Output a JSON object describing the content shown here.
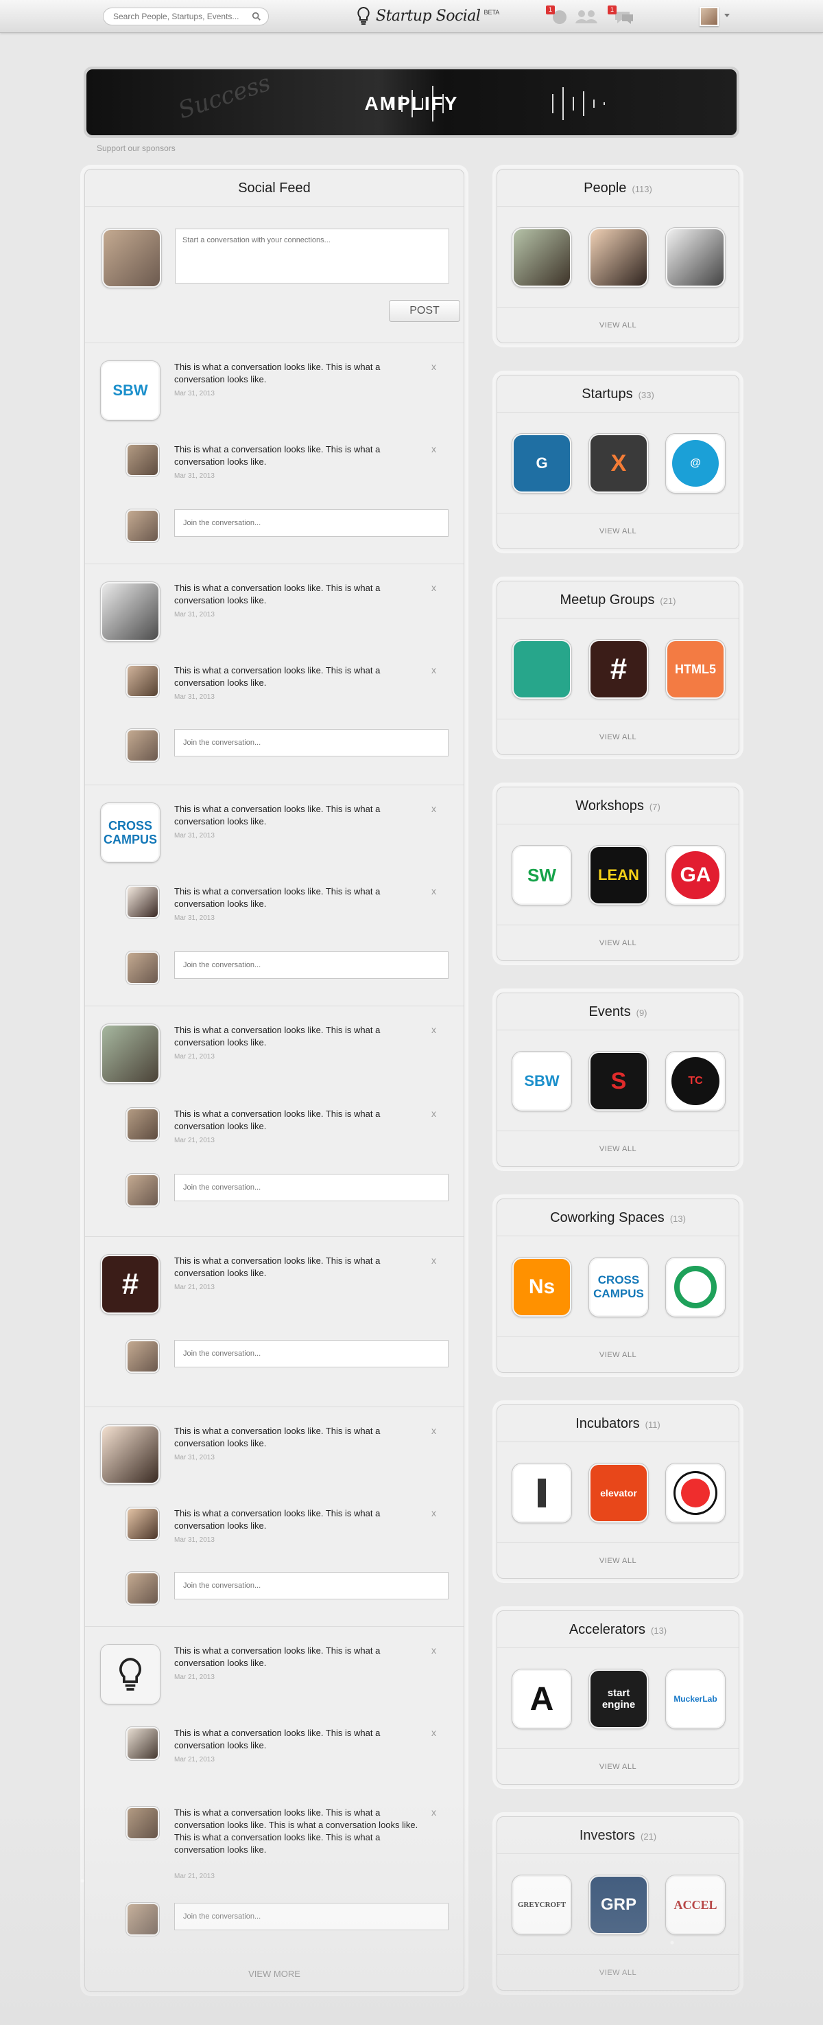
{
  "header": {
    "search_placeholder": "Search People, Startups, Events...",
    "brand": "Startup Social",
    "beta": "BETA",
    "notifications_count": "1",
    "messages_count": "1"
  },
  "banner": {
    "title": "AMPLIFY",
    "script": "Success",
    "sponsor_link": "Support our sponsors"
  },
  "feed": {
    "title": "Social Feed",
    "composer_placeholder": "Start a conversation with your connections...",
    "post_label": "POST",
    "message": "This is what a conversation looks like. This is what a conversation looks like.",
    "long_message": "This is what a conversation looks like. This is what a conversation looks like. This is what a conversation looks like. This is what a conversation looks like. This is what a conversation looks like.",
    "reply_placeholder": "Join the conversation...",
    "dates": [
      "Mar 31, 2013",
      "Mar 31, 2013",
      "Mar 31, 2013",
      "Mar 31, 2013",
      "Mar 31, 2013",
      "Mar 31, 2013",
      "Mar 21, 2013",
      "Mar 21, 2013",
      "Mar 21, 2013",
      "Mar 31, 2013",
      "Mar 31, 2013",
      "Mar 21, 2013",
      "Mar 21, 2013",
      "Mar 21, 2013"
    ],
    "view_more": "VIEW MORE"
  },
  "sidebar": {
    "view_all": "VIEW ALL",
    "sections": [
      {
        "title": "People",
        "count": "(113)"
      },
      {
        "title": "Startups",
        "count": "(33)"
      },
      {
        "title": "Meetup Groups",
        "count": "(21)"
      },
      {
        "title": "Workshops",
        "count": "(7)"
      },
      {
        "title": "Events",
        "count": "(9)"
      },
      {
        "title": "Coworking Spaces",
        "count": "(13)"
      },
      {
        "title": "Incubators",
        "count": "(11)"
      },
      {
        "title": "Accelerators",
        "count": "(13)"
      },
      {
        "title": "Investors",
        "count": "(21)"
      }
    ]
  },
  "tile_labels": {
    "cross_campus": "CROSS CAMPUS",
    "happy_hour": "#",
    "lean": "LEAN",
    "ga": "GA",
    "ns": "Ns",
    "amplify": "A",
    "start_engine": "start engine",
    "mucker": "MuckerLab",
    "greycroft": "GREYCROFT",
    "grp": "GRP",
    "accel": "ACCEL"
  }
}
